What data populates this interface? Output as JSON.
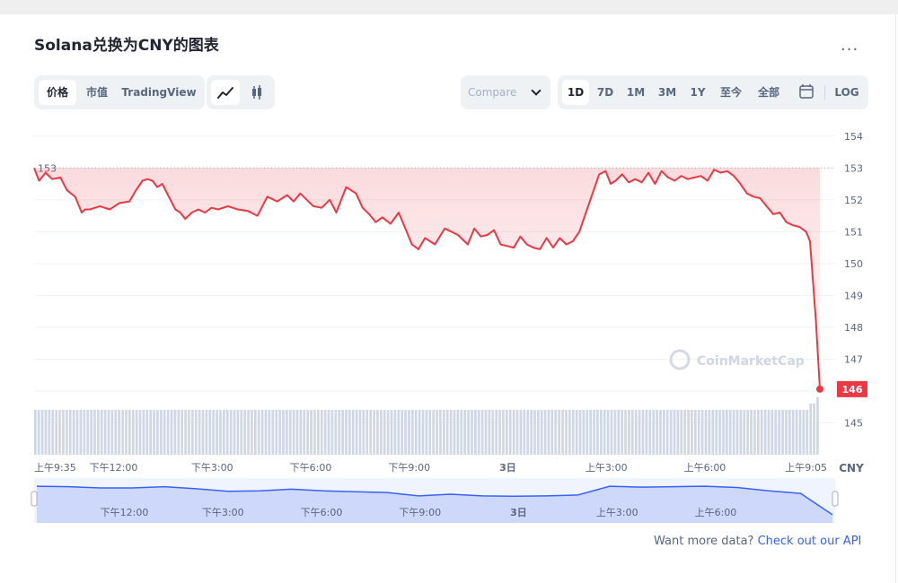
{
  "title": "Solana兑换为CNY的图表",
  "more_label": "...",
  "tabs": [
    "价格",
    "市值",
    "TradingView"
  ],
  "compare_label": "Compare",
  "ranges": [
    "1D",
    "7D",
    "1M",
    "3M",
    "1Y",
    "至今",
    "全部"
  ],
  "log_label": "LOG",
  "watermark": "CoinMarketCap",
  "footer": {
    "prefix": "Want more data?",
    "link": "Check out our API"
  },
  "colors": {
    "line": "#ea3943",
    "accent": "#3861fb",
    "volume": "#cfd6e4"
  },
  "chart_data": {
    "type": "line",
    "currency_label": "CNY",
    "ylim": [
      144,
      154.5
    ],
    "y_ticks": [
      154,
      153,
      152,
      151,
      150,
      149,
      148,
      147,
      146,
      145
    ],
    "open_price": 153,
    "open_price_label": "153",
    "current_price": 146.06,
    "current_price_label": "146",
    "x_ticks": [
      {
        "label": "上午9:35",
        "x": 0
      },
      {
        "label": "下午12:00",
        "x": 2.42
      },
      {
        "label": "下午3:00",
        "x": 5.42
      },
      {
        "label": "下午6:00",
        "x": 8.42
      },
      {
        "label": "下午9:00",
        "x": 11.42
      },
      {
        "label": "3日",
        "x": 14.42
      },
      {
        "label": "上午3:00",
        "x": 17.42
      },
      {
        "label": "上午6:00",
        "x": 20.42
      },
      {
        "label": "上午9:05",
        "x": 23.5
      }
    ],
    "nav_ticks": [
      {
        "label": "下午12:00",
        "x": 2.42
      },
      {
        "label": "下午3:00",
        "x": 5.42
      },
      {
        "label": "下午6:00",
        "x": 8.42
      },
      {
        "label": "下午9:00",
        "x": 11.42
      },
      {
        "label": "3日",
        "x": 14.42
      },
      {
        "label": "上午3:00",
        "x": 17.42
      },
      {
        "label": "上午6:00",
        "x": 20.42
      }
    ],
    "series": [
      {
        "x": [
          0,
          0.15,
          0.35,
          0.55,
          0.8,
          1.0,
          1.25,
          1.45,
          1.55,
          1.7,
          2.0,
          2.3,
          2.6,
          2.9,
          3.1,
          3.3,
          3.45,
          3.6,
          3.75,
          3.9,
          4.1,
          4.3,
          4.45,
          4.6,
          4.8,
          5.0,
          5.2,
          5.4,
          5.6,
          5.9,
          6.2,
          6.5,
          6.8,
          7.1,
          7.4,
          7.7,
          7.9,
          8.1,
          8.3,
          8.5,
          8.75,
          9.0,
          9.2,
          9.5,
          9.8,
          10.0,
          10.2,
          10.4,
          10.6,
          10.85,
          11.1,
          11.3,
          11.5,
          11.7,
          11.9,
          12.2,
          12.5,
          12.7,
          12.9,
          13.2,
          13.4,
          13.6,
          13.8,
          14.0,
          14.2,
          14.4,
          14.6,
          14.8,
          15.0,
          15.2,
          15.4,
          15.6,
          15.8,
          16.0,
          16.2,
          16.4,
          16.6,
          16.8,
          17.0,
          17.2,
          17.4,
          17.55,
          17.7,
          17.9,
          18.1,
          18.3,
          18.5,
          18.7,
          18.9,
          19.1,
          19.3,
          19.5,
          19.7,
          19.9,
          20.1,
          20.3,
          20.5,
          20.7,
          20.9,
          21.1,
          21.3,
          21.5,
          21.7,
          21.9,
          22.1,
          22.3,
          22.5,
          22.7,
          22.9,
          23.1,
          23.3,
          23.5,
          23.62,
          23.8,
          23.92
        ],
        "y": [
          153.0,
          152.6,
          152.85,
          152.65,
          152.7,
          152.3,
          152.1,
          151.6,
          151.7,
          151.7,
          151.8,
          151.7,
          151.9,
          151.95,
          152.3,
          152.6,
          152.65,
          152.6,
          152.4,
          152.5,
          152.1,
          151.7,
          151.6,
          151.4,
          151.6,
          151.7,
          151.6,
          151.75,
          151.7,
          151.8,
          151.7,
          151.65,
          151.5,
          152.1,
          151.95,
          152.15,
          151.95,
          152.2,
          152.0,
          151.8,
          151.75,
          152.0,
          151.6,
          152.4,
          152.2,
          151.75,
          151.55,
          151.3,
          151.45,
          151.25,
          151.6,
          151.1,
          150.6,
          150.45,
          150.8,
          150.6,
          151.1,
          151.0,
          150.9,
          150.6,
          151.1,
          150.85,
          150.9,
          151.05,
          150.6,
          150.55,
          150.5,
          150.85,
          150.6,
          150.5,
          150.45,
          150.8,
          150.5,
          150.8,
          150.6,
          150.7,
          151.0,
          151.6,
          152.2,
          152.8,
          152.9,
          152.5,
          152.6,
          152.8,
          152.55,
          152.65,
          152.55,
          152.85,
          152.5,
          152.9,
          152.7,
          152.6,
          152.75,
          152.65,
          152.7,
          152.75,
          152.6,
          152.95,
          152.85,
          152.9,
          152.75,
          152.5,
          152.2,
          152.1,
          152.05,
          151.8,
          151.55,
          151.6,
          151.3,
          151.2,
          151.15,
          151.0,
          150.7,
          148.2,
          146.06
        ]
      }
    ],
    "nav_series": [
      152.9,
      152.8,
      152.5,
      152.5,
      152.8,
      152.3,
      151.7,
      151.8,
      152.2,
      151.8,
      151.6,
      151.4,
      150.6,
      151.0,
      150.6,
      150.5,
      150.6,
      150.8,
      152.9,
      152.7,
      152.8,
      152.9,
      152.6,
      151.8,
      151.2,
      146.1
    ],
    "volume": [
      7,
      7,
      7,
      7,
      7,
      7,
      7,
      7,
      7,
      7,
      7,
      7,
      7,
      7,
      7,
      7,
      7,
      7,
      7,
      7,
      7,
      7,
      7,
      7,
      7,
      7,
      7,
      7,
      7,
      7,
      7,
      7,
      7,
      7,
      7,
      7,
      7,
      7,
      7,
      7,
      7,
      7,
      7,
      7,
      7,
      7,
      7,
      7,
      7,
      7,
      7,
      7,
      7,
      7,
      7,
      7,
      7,
      7,
      7,
      7,
      7,
      7,
      7,
      7,
      7,
      7,
      7,
      7,
      7,
      7,
      7,
      7,
      7,
      7,
      7,
      7,
      7,
      7,
      7,
      7,
      7,
      7,
      7,
      7,
      7,
      7,
      7,
      7,
      7,
      7,
      7,
      7,
      7,
      7,
      7,
      7,
      7,
      7,
      7,
      7,
      7,
      7,
      7,
      7,
      7,
      7,
      7,
      7,
      7,
      7,
      7,
      7,
      7,
      7,
      7,
      7,
      7,
      7,
      7,
      7,
      7,
      7,
      7,
      7,
      7,
      7,
      7,
      7,
      7,
      7,
      7,
      7,
      7,
      7,
      7,
      7,
      7,
      7,
      7,
      7,
      7,
      7,
      7,
      7,
      7,
      7,
      7,
      7,
      7,
      7,
      7,
      7,
      7,
      7,
      7,
      7,
      7,
      7,
      7,
      7,
      7,
      7,
      7,
      7,
      7,
      7,
      7,
      7,
      7,
      7,
      7,
      7,
      7,
      7,
      7,
      7,
      7,
      7,
      7,
      7,
      7,
      7,
      7,
      7,
      7,
      7,
      7,
      7,
      7,
      7,
      7,
      7,
      7,
      7,
      7,
      7,
      7,
      7,
      7,
      7,
      7,
      7,
      7,
      7,
      7,
      7,
      7,
      7,
      7,
      7,
      7,
      7,
      7,
      7,
      7,
      7,
      7,
      7,
      7,
      7,
      7,
      7,
      8,
      8,
      9
    ]
  }
}
